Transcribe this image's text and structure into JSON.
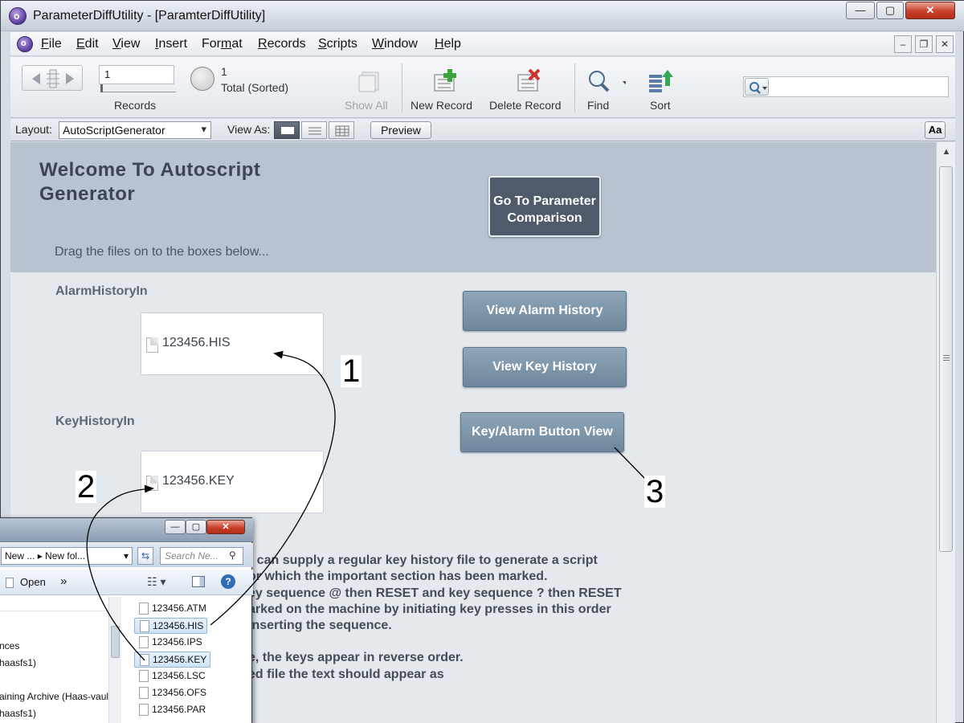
{
  "window": {
    "title": "ParameterDiffUtility - [ParamterDiffUtility]",
    "min": "—",
    "max": "▢",
    "close": "✕"
  },
  "menubar": {
    "items": [
      {
        "pre": "",
        "u": "F",
        "post": "ile"
      },
      {
        "pre": "",
        "u": "E",
        "post": "dit"
      },
      {
        "pre": "",
        "u": "V",
        "post": "iew"
      },
      {
        "pre": "",
        "u": "I",
        "post": "nsert"
      },
      {
        "pre": "For",
        "u": "m",
        "post": "at"
      },
      {
        "pre": "",
        "u": "R",
        "post": "ecords"
      },
      {
        "pre": "",
        "u": "S",
        "post": "cripts"
      },
      {
        "pre": "",
        "u": "W",
        "post": "indow"
      },
      {
        "pre": "",
        "u": "H",
        "post": "elp"
      }
    ]
  },
  "toolbar": {
    "record_value": "1",
    "records_label": "Records",
    "found_count": "1",
    "total_label": "Total (Sorted)",
    "show_all": "Show All",
    "new_record": "New Record",
    "delete_record": "Delete Record",
    "find": "Find",
    "sort": "Sort"
  },
  "layoutbar": {
    "layout_label": "Layout:",
    "layout_value": "AutoScriptGenerator",
    "view_as_label": "View As:",
    "preview": "Preview",
    "aa": "Aa"
  },
  "content": {
    "welcome_line1": "Welcome To Autoscript",
    "welcome_line2": "Generator",
    "goto_line1": "Go To Parameter",
    "goto_line2": "Comparison",
    "drag_hint": "Drag the files on to the boxes below...",
    "alarm_label": "AlarmHistoryIn",
    "alarm_file": "123456.HIS",
    "key_label": "KeyHistoryIn",
    "key_file": "123456.KEY",
    "btn_view_alarm": "View Alarm History",
    "btn_view_key": "View Key History",
    "btn_key_alarm": "Key/Alarm Button View",
    "desc_lines": [
      "r can supply a regular key history file to generate a script",
      "or which the important section has been marked.",
      "ey sequence @ then RESET and  key sequence ? then RESET",
      "arked on the machine by initiating key presses in this order",
      " inserting the sequence.",
      "",
      "e, the keys appear in reverse order.",
      "ed file the text should appear as"
    ]
  },
  "explorer": {
    "crumb1": "New ...",
    "crumb2": "New fol...",
    "search_placeholder": "Search Ne...",
    "open_label": "Open",
    "more": "»",
    "nav_items": [
      "nces",
      "haasfs1)",
      "aining Archive (Haas-vault",
      "haasfs1)"
    ],
    "files": [
      "123456.ATM",
      "123456.HIS",
      "123456.IPS",
      "123456.KEY",
      "123456.LSC",
      "123456.OFS",
      "123456.PAR"
    ],
    "selected": [
      "123456.HIS",
      "123456.KEY"
    ]
  },
  "annotations": {
    "a1": "1",
    "a2": "2",
    "a3": "3"
  }
}
